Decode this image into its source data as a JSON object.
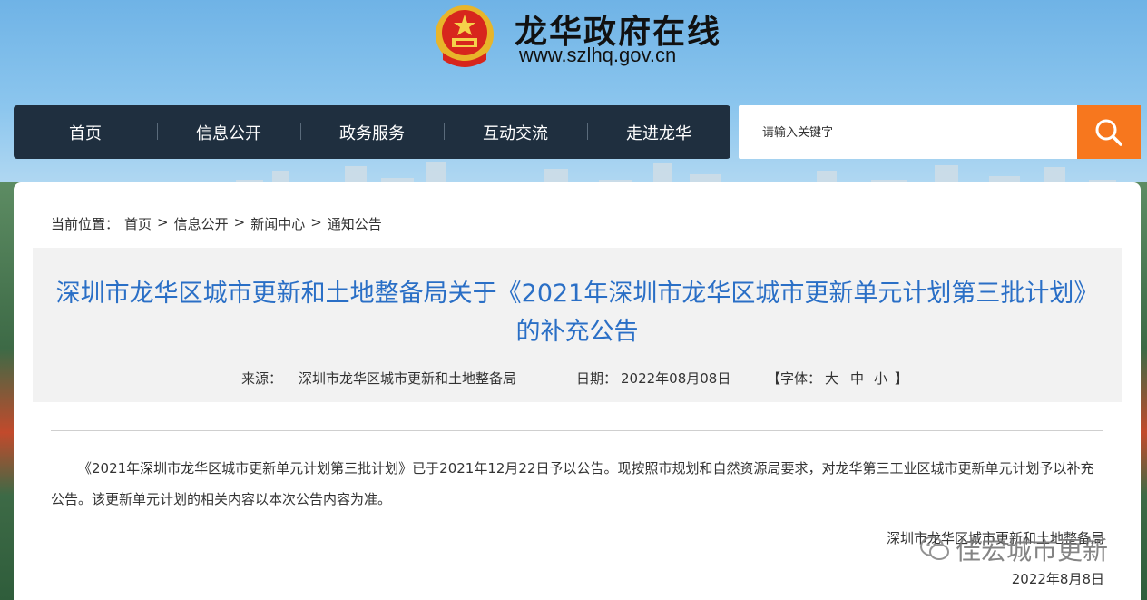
{
  "header": {
    "site_title": "龙华政府在线",
    "site_url": "www.szlhq.gov.cn"
  },
  "nav": {
    "items": [
      "首页",
      "信息公开",
      "政务服务",
      "互动交流",
      "走进龙华"
    ]
  },
  "search": {
    "placeholder": "请输入关键字"
  },
  "breadcrumb": {
    "prefix": "当前位置：",
    "items": [
      "首页",
      "信息公开",
      "新闻中心",
      "通知公告"
    ],
    "separator": ">"
  },
  "article": {
    "title": "深圳市龙华区城市更新和土地整备局关于《2021年深圳市龙华区城市更新单元计划第三批计划》的补充公告",
    "source_label": "来源：",
    "source": "深圳市龙华区城市更新和土地整备局",
    "date_label": "日期：",
    "date": "2022年08月08日",
    "font_label": "【字体：",
    "font_large": "大",
    "font_medium": "中",
    "font_small": "小",
    "font_close": "】",
    "body": "《2021年深圳市龙华区城市更新单元计划第三批计划》已于2021年12月22日予以公告。现按照市规划和自然资源局要求，对龙华第三工业区城市更新单元计划予以补充公告。该更新单元计划的相关内容以本次公告内容为准。",
    "sign_org": "深圳市龙华区城市更新和土地整备局",
    "sign_date": "2022年8月8日"
  },
  "watermark": {
    "text": "佳宏城市更新"
  },
  "colors": {
    "nav_bg": "#1f2f3f",
    "search_btn": "#f7771e",
    "title_blue": "#2a6fc6"
  }
}
